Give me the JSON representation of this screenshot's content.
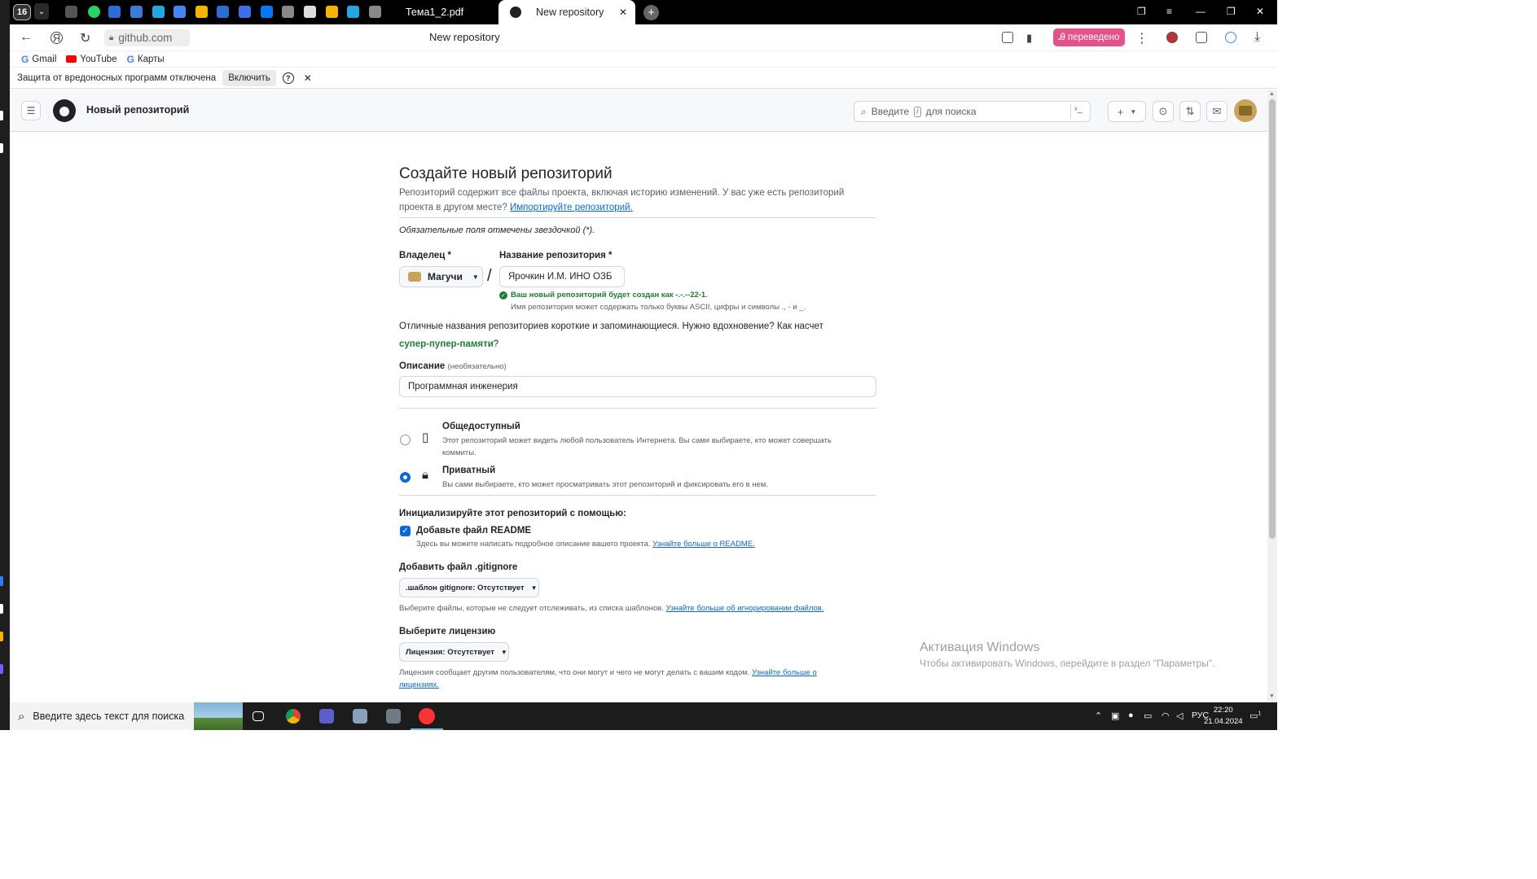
{
  "browser": {
    "tab_count": "16",
    "tabs": [
      {
        "label": "Тема1_2.pdf"
      },
      {
        "label": "New repository"
      }
    ],
    "address": "github.com",
    "page_title": "New repository",
    "translate_badge": "переведено",
    "bookmarks": [
      {
        "label": "Gmail",
        "icon": "google-icon"
      },
      {
        "label": "YouTube",
        "icon": "youtube-icon"
      },
      {
        "label": "Карты",
        "icon": "google-icon"
      }
    ],
    "infobar": {
      "text": "Защита от вредоносных программ отключена",
      "button": "Включить"
    }
  },
  "github": {
    "header_title": "Новый репозиторий",
    "search_placeholder_before": "Введите",
    "search_key": "/",
    "search_placeholder_after": "для поиска",
    "new_menu": "+"
  },
  "form": {
    "title": "Создайте новый репозиторий",
    "subtitle": "Репозиторий содержит все файлы проекта, включая историю изменений. У вас уже есть репозиторий проекта в другом месте?",
    "import_link": "Импортируйте репозиторий.",
    "required_note": "Обязательные поля отмечены звездочкой (*).",
    "owner_label": "Владелец *",
    "owner_value": "Магучи",
    "repo_name_label": "Название репозитория *",
    "repo_name_value": "Ярочкин И.М. ИНО ОЗБ",
    "name_ok": "Ваш новый репозиторий будет создан как -.-.--22-1.",
    "name_hint": "Имя репозитория может содержать только буквы ASCII, цифры и символы ., - и _.",
    "inspiration": "Отличные названия репозиториев короткие и запоминающиеся. Нужно вдохновение? Как насчет",
    "suggestion": "супер-пупер-памяти",
    "suggestion_end": "?",
    "description_label": "Описание",
    "description_optional": "(необязательно)",
    "description_value": "Программная инженерия",
    "visibility": {
      "public_title": "Общедоступный",
      "public_desc": "Этот репозиторий может видеть любой пользователь Интернета. Вы сами выбираете, кто может совершать коммиты.",
      "private_title": "Приватный",
      "private_desc": "Вы сами выбираете, кто может просматривать этот репозиторий и фиксировать его в нем.",
      "selected": "private"
    },
    "init_title": "Инициализируйте этот репозиторий с помощью:",
    "readme_label": "Добавьте файл README",
    "readme_checked": true,
    "readme_hint": "Здесь вы можете написать подробное описание вашего проекта.",
    "readme_link": "Узнайте больше о README.",
    "gitignore_title": "Добавить файл .gitignore",
    "gitignore_select": ".шаблон gitignore: Отсутствует",
    "gitignore_hint": "Выберите файлы, которые не следует отслеживать, из списка шаблонов.",
    "gitignore_link": "Узнайте больше об игнорировании файлов.",
    "license_title": "Выберите лицензию",
    "license_select": "Лицензия: Отсутствует",
    "license_hint": "Лицензия сообщает другим пользователям, что они могут и чего не могут делать с вашим кодом.",
    "license_link": "Узнайте больше о лицензиях."
  },
  "watermark": {
    "title": "Активация Windows",
    "text": "Чтобы активировать Windows, перейдите в раздел \"Параметры\"."
  },
  "taskbar": {
    "search_placeholder": "Введите здесь текст для поиска",
    "language": "РУС",
    "time": "22:20",
    "date": "21.04.2024",
    "notifications": "1"
  },
  "colors": {
    "accent": "#0969da",
    "success": "#1a7f37",
    "translate_badge": "#e6518b"
  }
}
